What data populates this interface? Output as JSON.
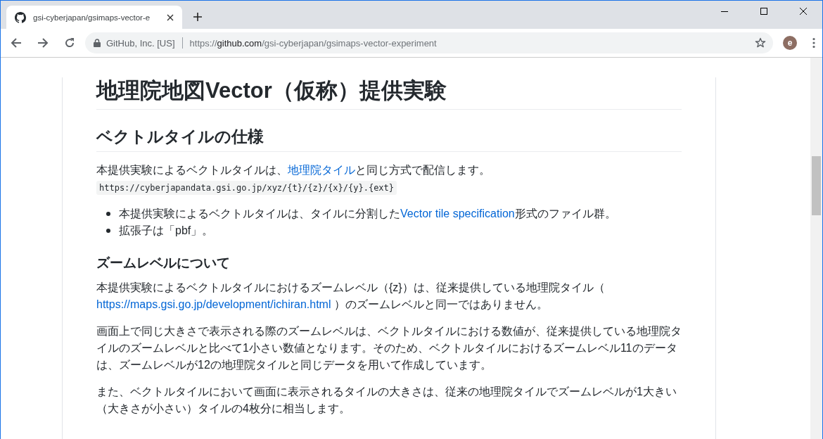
{
  "browser": {
    "tab": {
      "title": "gsi-cyberjapan/gsimaps-vector-e",
      "selected": true
    },
    "address": {
      "site": "GitHub, Inc. [US]",
      "url_scheme": "https://",
      "url_host": "github.com",
      "url_path": "/gsi-cyberjapan/gsimaps-vector-experiment"
    },
    "avatar": "e"
  },
  "article": {
    "title": "地理院地図Vector（仮称）提供実験",
    "blocks": [
      {
        "kind": "heading",
        "text": "ベクトルタイルの仕様"
      },
      {
        "kind": "paragraph",
        "parts": [
          {
            "kind": "text",
            "text": "本提供実験によるベクトルタイルは、"
          },
          {
            "kind": "link",
            "text": "地理院タイル"
          },
          {
            "kind": "text",
            "text": "と同じ方式で配信します。"
          }
        ]
      },
      {
        "kind": "code",
        "text": "https://cyberjapandata.gsi.go.jp/xyz/{t}/{z}/{x}/{y}.{ext}"
      },
      {
        "kind": "list",
        "items": [
          [
            {
              "kind": "text",
              "text": "本提供実験によるベクトルタイルは、タイルに分割した"
            },
            {
              "kind": "link",
              "text": "Vector tile specification"
            },
            {
              "kind": "text",
              "text": "形式のファイル群。"
            }
          ],
          [
            {
              "kind": "text",
              "text": "拡張子は「pbf」。"
            }
          ]
        ]
      },
      {
        "kind": "subheading",
        "text": "ズームレベルについて"
      },
      {
        "kind": "paragraph",
        "parts": [
          {
            "kind": "text",
            "text": "本提供実験によるベクトルタイルにおけるズームレベル（{z}）は、従来提供している地理院タイル（ "
          },
          {
            "kind": "link",
            "text": "https://maps.gsi.go.jp/development/ichiran.html"
          },
          {
            "kind": "text",
            "text": " ）のズームレベルと同一ではありません。"
          }
        ]
      },
      {
        "kind": "paragraph",
        "parts": [
          {
            "kind": "text",
            "text": "画面上で同じ大きさで表示される際のズームレベルは、ベクトルタイルにおける数値が、従来提供している地理院タイルのズームレベルと比べて1小さい数値となります。そのため、ベクトルタイルにおけるズームレベル11のデータは、ズームレベルが12の地理院タイルと同じデータを用いて作成しています。"
          }
        ]
      },
      {
        "kind": "paragraph",
        "parts": [
          {
            "kind": "text",
            "text": "また、ベクトルタイルにおいて画面に表示されるタイルの大きさは、従来の地理院タイルでズームレベルが1大きい（大きさが小さい）タイルの4枚分に相当します。"
          }
        ]
      }
    ]
  }
}
